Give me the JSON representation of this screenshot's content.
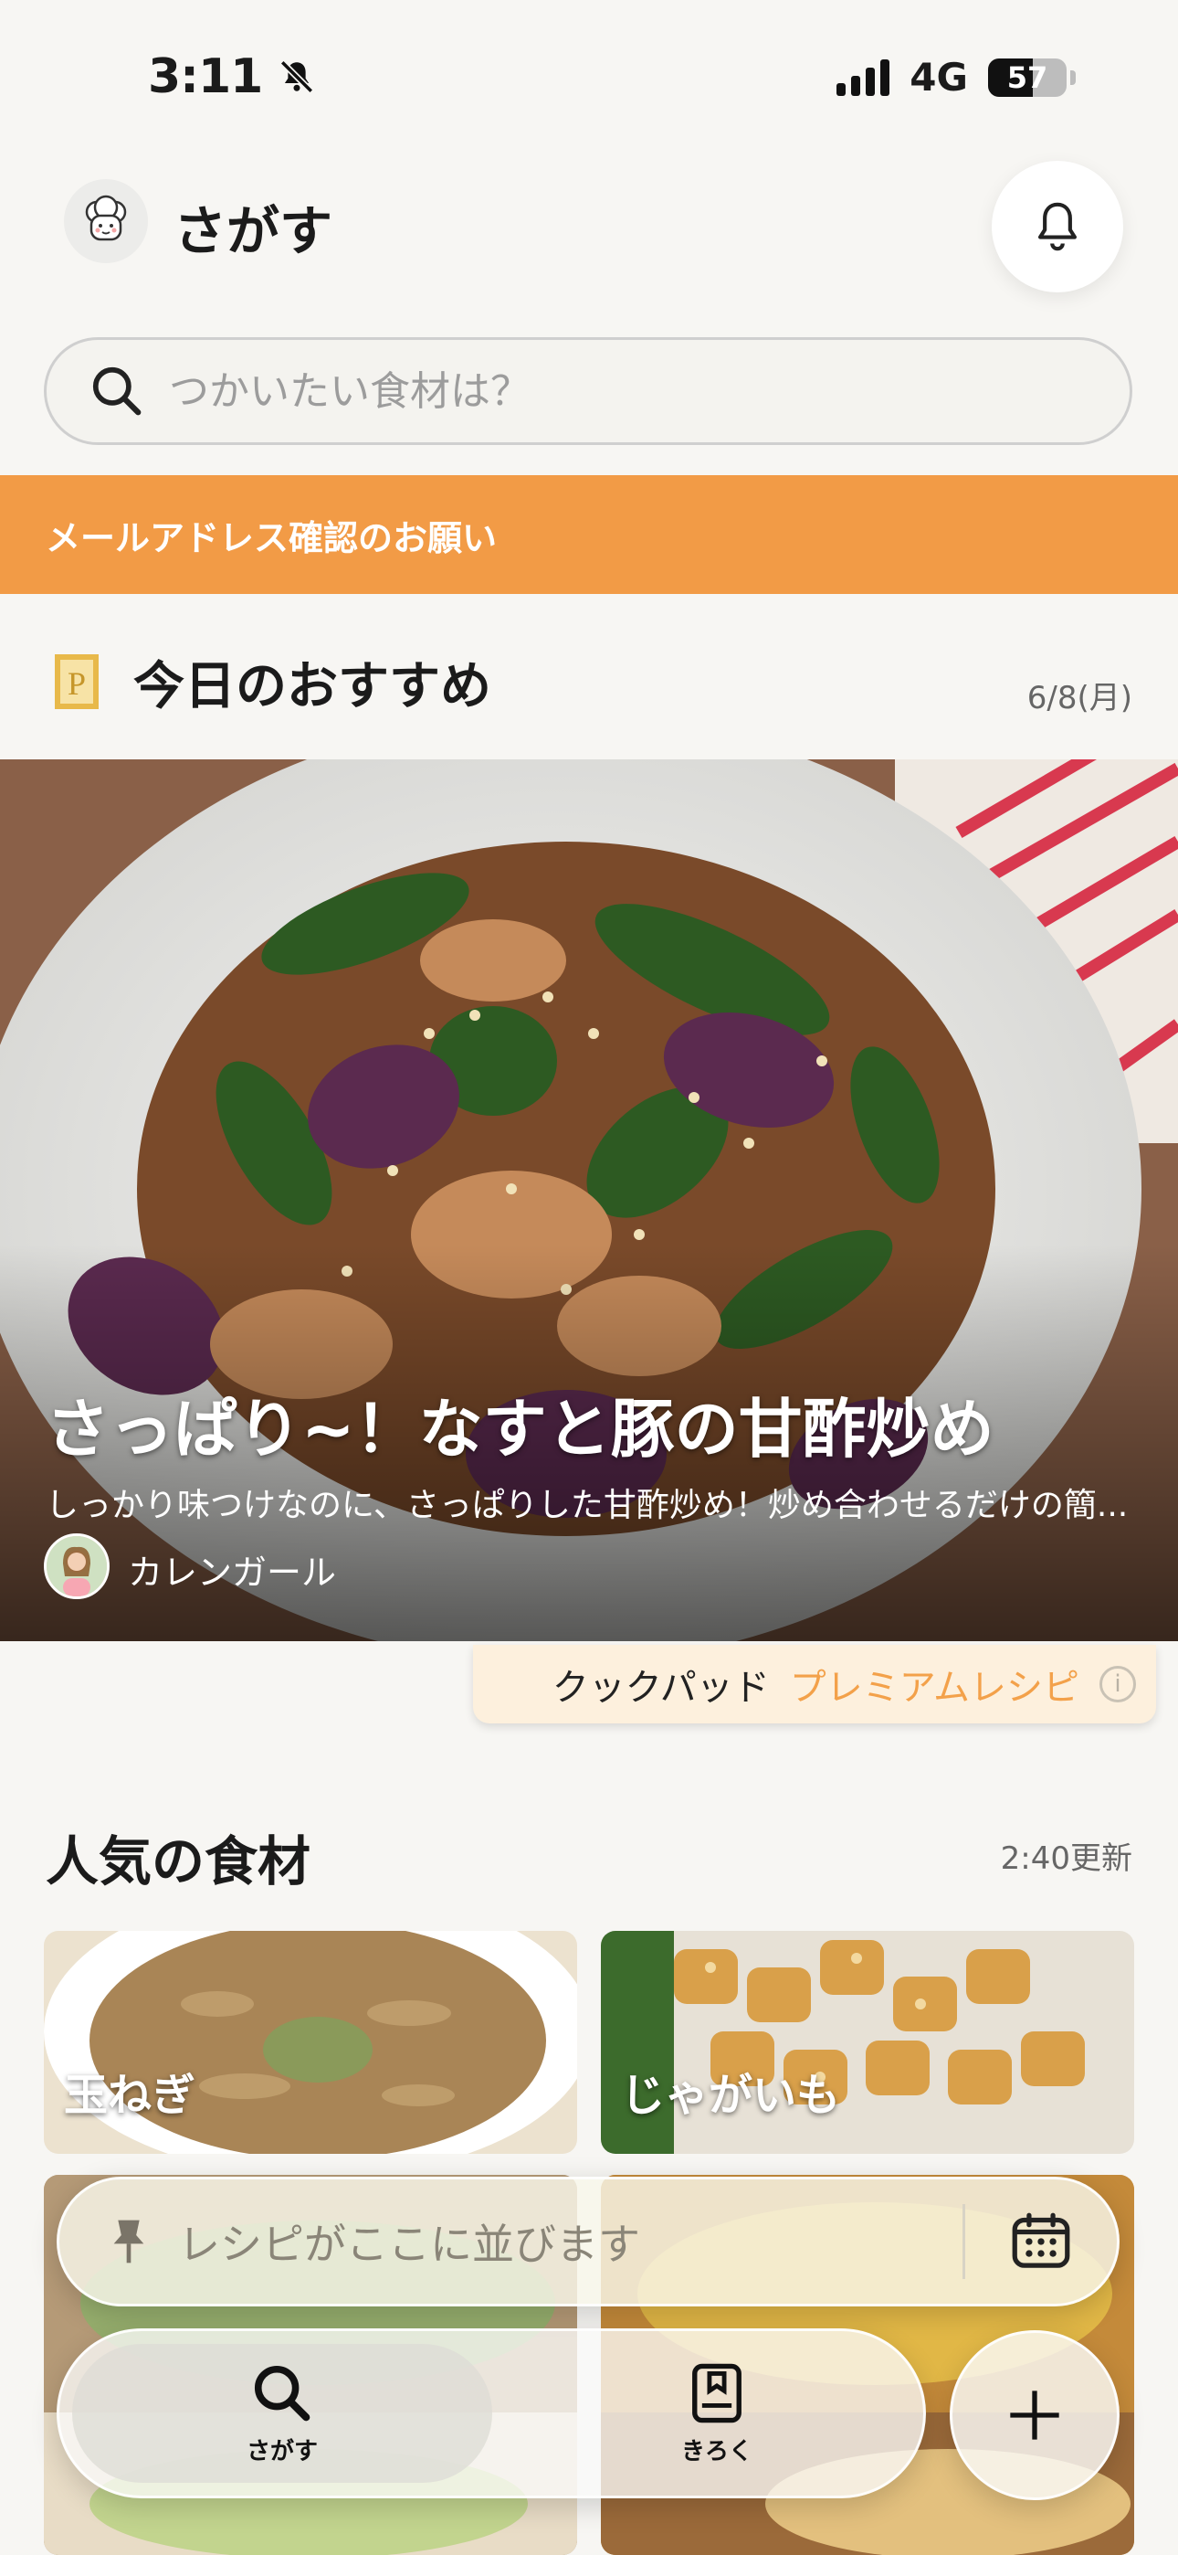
{
  "status_bar": {
    "time": "3:11",
    "network": "4G",
    "battery": "57",
    "battery_level": 0.57
  },
  "header": {
    "title": "さがす"
  },
  "search": {
    "placeholder": "つかいたい食材は？"
  },
  "banner": {
    "text": "メールアドレス確認のお願い"
  },
  "recommend": {
    "title": "今日のおすすめ",
    "date": "6/8(月)",
    "recipe_title": "さっぱり~！なすと豚の甘酢炒め",
    "recipe_desc": "しっかり味つけなのに、さっぱりした甘酢炒め！炒め合わせるだけの簡...",
    "author": "カレンガール"
  },
  "premium": {
    "label_a": "クックパッド",
    "label_b": "プレミアムレシピ",
    "info_icon": "i"
  },
  "popular": {
    "title": "人気の食材",
    "updated": "2:40更新",
    "items": [
      {
        "label": "玉ねぎ"
      },
      {
        "label": "じゃがいも"
      }
    ]
  },
  "list_pill": {
    "text": "レシピがここに並びます"
  },
  "tabs": [
    {
      "label": "さがす",
      "icon": "search-icon"
    },
    {
      "label": "きろく",
      "icon": "book-icon"
    }
  ],
  "colors": {
    "accent": "#f29b46",
    "premium": "#f3a14a"
  }
}
